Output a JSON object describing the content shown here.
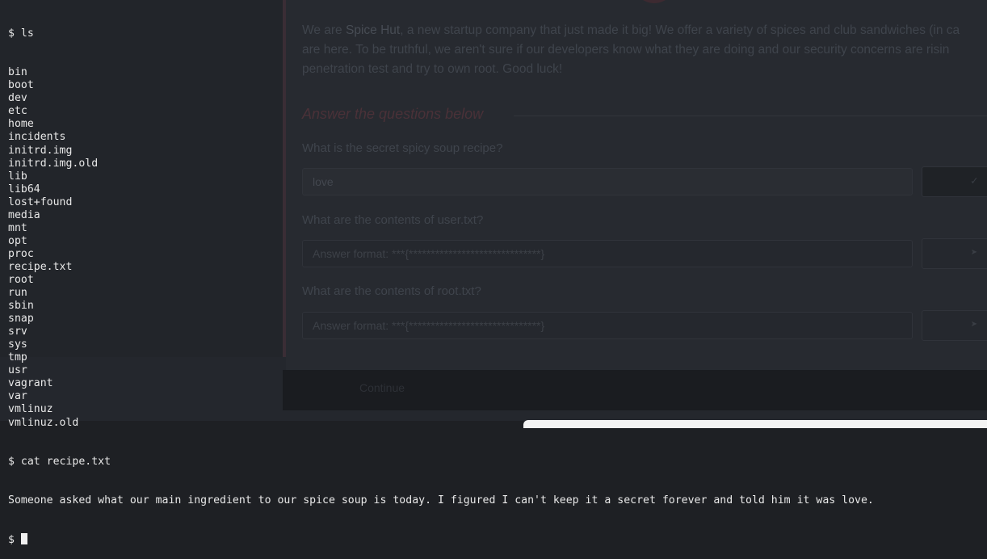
{
  "terminal": {
    "command1": "$ ls",
    "listing": [
      "bin",
      "boot",
      "dev",
      "etc",
      "home",
      "incidents",
      "initrd.img",
      "initrd.img.old",
      "lib",
      "lib64",
      "lost+found",
      "media",
      "mnt",
      "opt",
      "proc",
      "recipe.txt",
      "root",
      "run",
      "sbin",
      "snap",
      "srv",
      "sys",
      "tmp",
      "usr",
      "vagrant",
      "var",
      "vmlinuz",
      "vmlinuz.old"
    ],
    "command2": "$ cat recipe.txt",
    "output": "Someone asked what our main ingredient to our spice soup is today. I figured I can't keep it a secret forever and told him it was love.",
    "prompt": "$"
  },
  "room": {
    "intro_brand_prefix": "We are ",
    "intro_brand": "Spice Hut",
    "intro_line1_rest": ", a new startup company that just made it big! We offer a variety of spices and club sandwiches (in ca",
    "intro_line2": "are here. To be truthful, we aren't sure if our developers know what they are doing and our security concerns are risin",
    "intro_line3": "penetration test and try to own root. Good luck!",
    "section_title": "Answer the questions below",
    "questions": [
      {
        "text": "What is the secret spicy soup recipe?",
        "answer": "love",
        "placeholder": ""
      },
      {
        "text": "What are the contents of user.txt?",
        "answer": "",
        "placeholder": "Answer format: ***{******************************}"
      },
      {
        "text": "What are the contents of root.txt?",
        "answer": "",
        "placeholder": "Answer format: ***{******************************}"
      }
    ],
    "bottom_label": "Continue"
  },
  "colors": {
    "terminal_text": "#e8e8e8",
    "background": "#1e2024",
    "accent": "#4a3138"
  }
}
